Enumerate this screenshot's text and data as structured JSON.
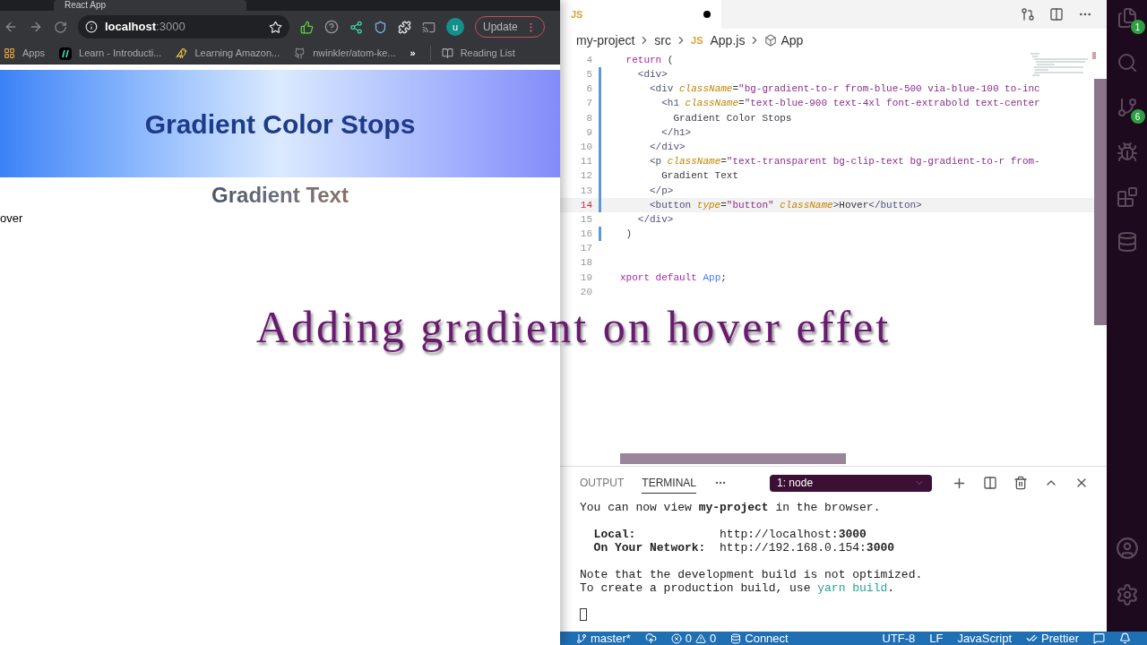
{
  "browser": {
    "tab": {
      "title": "React App"
    },
    "url": {
      "host": "localhost",
      "port": ":3000"
    },
    "profile_initial": "u",
    "update_button": "Update",
    "bookmarks": [
      {
        "label": "Apps",
        "kind": "apps"
      },
      {
        "label": "Learn - Introducti...",
        "kind": "slashes"
      },
      {
        "label": "Learning Amazon...",
        "kind": "duck"
      },
      {
        "label": "nwinkler/atom-ke...",
        "kind": "github"
      }
    ],
    "overflow": "»",
    "reading_list": "Reading List",
    "page": {
      "heading": "Gradient Color Stops",
      "gradient_text": "Gradient Text",
      "hover_button": "over"
    }
  },
  "caption": "Adding gradient on hover effet",
  "editor": {
    "tab": {
      "icon_label": "JS",
      "modified": true
    },
    "breadcrumbs": [
      {
        "label": "my-project",
        "kind": "folder"
      },
      {
        "label": "src",
        "kind": "folder"
      },
      {
        "label": "App.js",
        "kind": "file",
        "icon_label": "JS"
      },
      {
        "label": "App",
        "kind": "symbol"
      }
    ],
    "lines": [
      {
        "number": "4",
        "changed": false,
        "current": false,
        "tokens": [
          {
            "text": " return",
            "kind": "kw"
          },
          {
            "text": " (",
            "kind": "op"
          }
        ]
      },
      {
        "number": "5",
        "changed": true,
        "current": false,
        "tokens": [
          {
            "text": "   <div>",
            "kind": "tag"
          }
        ]
      },
      {
        "number": "6",
        "changed": true,
        "current": false,
        "tokens": [
          {
            "text": "     <div",
            "kind": "tag"
          },
          {
            "text": " className",
            "kind": "attr"
          },
          {
            "text": "=",
            "kind": "op"
          },
          {
            "text": "\"bg-gradient-to-r from-blue-500 via-blue-100 to-inc",
            "kind": "str"
          }
        ]
      },
      {
        "number": "7",
        "changed": true,
        "current": false,
        "tokens": [
          {
            "text": "       <h1",
            "kind": "tag"
          },
          {
            "text": " className",
            "kind": "attr"
          },
          {
            "text": "=",
            "kind": "op"
          },
          {
            "text": "\"text-blue-900 text-4xl font-extrabold text-center",
            "kind": "str"
          }
        ]
      },
      {
        "number": "8",
        "changed": true,
        "current": false,
        "tokens": [
          {
            "text": "         Gradient Color Stops",
            "kind": "text"
          }
        ]
      },
      {
        "number": "9",
        "changed": true,
        "current": false,
        "tokens": [
          {
            "text": "       </h1>",
            "kind": "tag"
          }
        ]
      },
      {
        "number": "10",
        "changed": true,
        "current": false,
        "tokens": [
          {
            "text": "     </div>",
            "kind": "tag"
          }
        ]
      },
      {
        "number": "11",
        "changed": true,
        "current": false,
        "tokens": [
          {
            "text": "     <p",
            "kind": "tag"
          },
          {
            "text": " className",
            "kind": "attr"
          },
          {
            "text": "=",
            "kind": "op"
          },
          {
            "text": "\"text-transparent bg-clip-text bg-gradient-to-r from-",
            "kind": "str"
          }
        ]
      },
      {
        "number": "12",
        "changed": true,
        "current": false,
        "tokens": [
          {
            "text": "       Gradient Text",
            "kind": "text"
          }
        ]
      },
      {
        "number": "13",
        "changed": true,
        "current": false,
        "tokens": [
          {
            "text": "     </p>",
            "kind": "tag"
          }
        ]
      },
      {
        "number": "14",
        "changed": true,
        "current": true,
        "tokens": [
          {
            "text": "     <button",
            "kind": "tag"
          },
          {
            "text": " type",
            "kind": "attr"
          },
          {
            "text": "=",
            "kind": "op"
          },
          {
            "text": "\"button\"",
            "kind": "str"
          },
          {
            "text": " className",
            "kind": "attr"
          },
          {
            "text": ">",
            "kind": "tag"
          },
          {
            "text": "Hover",
            "kind": "text"
          },
          {
            "text": "</button>",
            "kind": "tag"
          }
        ]
      },
      {
        "number": "15",
        "changed": false,
        "current": false,
        "tokens": [
          {
            "text": "   </div>",
            "kind": "tag"
          }
        ]
      },
      {
        "number": "16",
        "changed": true,
        "current": false,
        "tokens": [
          {
            "text": " )",
            "kind": "op"
          }
        ]
      },
      {
        "number": "17",
        "changed": false,
        "current": false
      },
      {
        "number": "18",
        "changed": false,
        "current": false
      },
      {
        "number": "19",
        "changed": false,
        "current": false,
        "tokens": [
          {
            "text": "xport default",
            "kind": "kw"
          },
          {
            "text": " App",
            "kind": "ident"
          },
          {
            "text": ";",
            "kind": "op"
          }
        ]
      },
      {
        "number": "20",
        "changed": false,
        "current": false
      }
    ]
  },
  "panel": {
    "tabs": [
      {
        "label": "OUTPUT",
        "selected": false
      },
      {
        "label": "TERMINAL",
        "selected": true
      }
    ],
    "terminal_select": "1: node",
    "terminal": [
      [
        [
          {
            "text": "You can now view ",
            "kind": "plain"
          },
          {
            "text": "my-project",
            "kind": "bold"
          },
          {
            "text": " in the browser.",
            "kind": "plain"
          }
        ]
      ],
      [
        [
          {
            "text": "  Local:            ",
            "kind": "bold"
          },
          {
            "text": "http://localhost:",
            "kind": "plain"
          },
          {
            "text": "3000",
            "kind": "bold"
          }
        ],
        [
          {
            "text": "  On Your Network:  ",
            "kind": "bold"
          },
          {
            "text": "http://192.168.0.154:",
            "kind": "plain"
          },
          {
            "text": "3000",
            "kind": "bold"
          }
        ]
      ],
      [
        [
          {
            "text": "Note that the development build is not optimized.",
            "kind": "plain"
          }
        ],
        [
          {
            "text": "To create a production build, use ",
            "kind": "plain"
          },
          {
            "text": "yarn build",
            "kind": "command"
          },
          {
            "text": ".",
            "kind": "plain"
          }
        ]
      ]
    ]
  },
  "status_bar": {
    "branch": "master*",
    "errors": "0",
    "warnings": "0",
    "connect": "Connect",
    "encoding": "UTF-8",
    "eol": "LF",
    "language": "JavaScript",
    "formatter": "Prettier"
  },
  "activity_bar": [
    {
      "kind": "files",
      "badge": "1"
    },
    {
      "kind": "search"
    },
    {
      "kind": "source-control",
      "badge": "6"
    },
    {
      "kind": "debug"
    },
    {
      "kind": "extensions"
    },
    {
      "kind": "database"
    },
    {
      "kind": "spacer"
    },
    {
      "kind": "account"
    },
    {
      "kind": "settings"
    }
  ]
}
